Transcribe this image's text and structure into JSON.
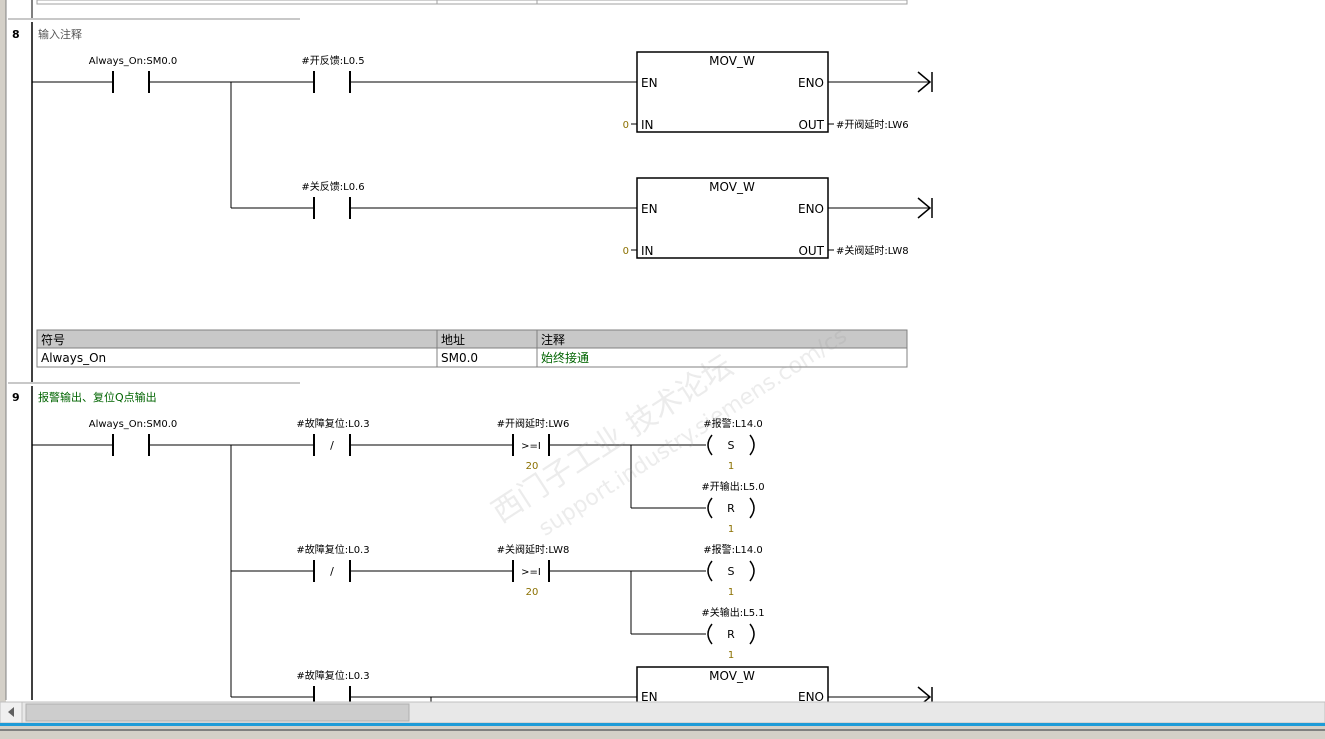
{
  "rungs": [
    {
      "number": "8",
      "comment": "输入注释",
      "contacts": [
        {
          "label": "Always_On:SM0.0"
        },
        {
          "label": "#开反馈:L0.5"
        },
        {
          "label": "#关反馈:L0.6"
        }
      ],
      "boxes": [
        {
          "title": "MOV_W",
          "en": "EN",
          "eno": "ENO",
          "in_pin": "IN",
          "out_pin": "OUT",
          "in_value": "0",
          "out_label": "#开阀延时:LW6"
        },
        {
          "title": "MOV_W",
          "en": "EN",
          "eno": "ENO",
          "in_pin": "IN",
          "out_pin": "OUT",
          "in_value": "0",
          "out_label": "#关阀延时:LW8"
        }
      ],
      "symbol_table": {
        "headers": [
          "符号",
          "地址",
          "注释"
        ],
        "rows": [
          [
            "Always_On",
            "SM0.0",
            "始终接通"
          ]
        ]
      }
    },
    {
      "number": "9",
      "comment": "报警输出、复位Q点输出",
      "contacts": [
        {
          "label": "Always_On:SM0.0"
        },
        {
          "label": "#故障复位:L0.3",
          "symbol": "/"
        },
        {
          "label": "#开阀延时:LW6",
          "symbol": ">=I",
          "value": "20"
        },
        {
          "label": "#故障复位:L0.3",
          "symbol": "/"
        },
        {
          "label": "#关阀延时:LW8",
          "symbol": ">=I",
          "value": "20"
        },
        {
          "label": "#故障复位:L0.3"
        }
      ],
      "coils": [
        {
          "label": "#报警:L14.0",
          "symbol": "S",
          "count": "1"
        },
        {
          "label": "#开输出:L5.0",
          "symbol": "R",
          "count": "1"
        },
        {
          "label": "#报警:L14.0",
          "symbol": "S",
          "count": "1"
        },
        {
          "label": "#关输出:L5.1",
          "symbol": "R",
          "count": "1"
        }
      ],
      "box": {
        "title": "MOV_W",
        "en": "EN",
        "eno": "ENO"
      }
    }
  ],
  "watermark": {
    "line1": "西门子工业  技术论坛",
    "line2": "support.industry.siemens.com/cs"
  },
  "colors": {
    "comment_green": "#006400",
    "value_olive": "#8b7000",
    "header_bg": "#c8c8c8"
  }
}
